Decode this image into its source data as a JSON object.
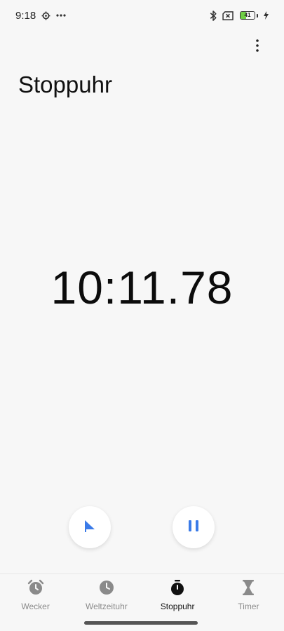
{
  "status_bar": {
    "time": "9:18",
    "battery_level": "41",
    "battery_fill_percent": 41,
    "icons": [
      "settings-icon",
      "more-notifications-icon",
      "bluetooth-icon",
      "no-sim-icon",
      "battery-icon",
      "charging-icon"
    ]
  },
  "header": {
    "title": "Stoppuhr",
    "menu_icon": "more-vert-icon"
  },
  "stopwatch": {
    "elapsed": "10:11.78",
    "lap_icon": "flag-icon",
    "pause_icon": "pause-icon"
  },
  "nav": {
    "items": [
      {
        "label": "Wecker",
        "icon": "alarm-clock-icon",
        "active": false
      },
      {
        "label": "Weltzeituhr",
        "icon": "clock-icon",
        "active": false
      },
      {
        "label": "Stoppuhr",
        "icon": "stopwatch-icon",
        "active": true
      },
      {
        "label": "Timer",
        "icon": "hourglass-icon",
        "active": false
      }
    ]
  },
  "colors": {
    "background": "#f7f7f7",
    "accent": "#3b7be8",
    "inactive": "#8a8a8a",
    "active": "#111111",
    "battery_fill": "#6fcf45"
  }
}
